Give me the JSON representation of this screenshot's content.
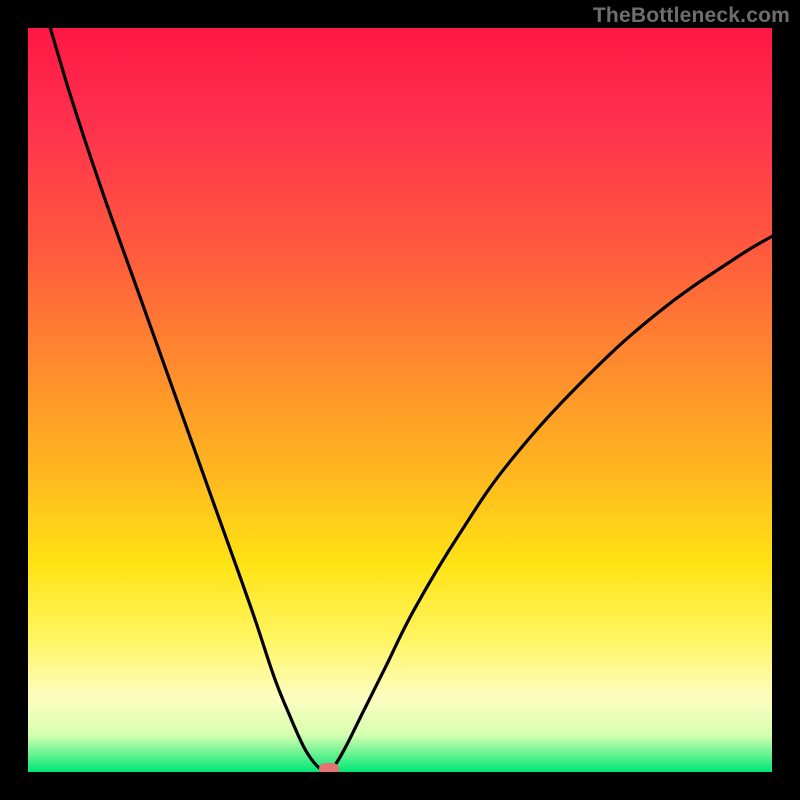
{
  "watermark": "TheBottleneck.com",
  "chart_data": {
    "type": "line",
    "title": "",
    "xlabel": "",
    "ylabel": "",
    "xlim": [
      0,
      100
    ],
    "ylim": [
      0,
      100
    ],
    "grid": false,
    "series": [
      {
        "name": "bottleneck-curve",
        "x": [
          3,
          6,
          10,
          15,
          20,
          25,
          30,
          33,
          35,
          37,
          38.5,
          39.5,
          40,
          40.8,
          42.5,
          45,
          48,
          52,
          58,
          65,
          75,
          85,
          95,
          100
        ],
        "values": [
          100,
          90,
          78,
          64,
          50,
          36,
          22,
          13,
          8,
          3.5,
          1.2,
          0.3,
          0,
          0.3,
          3,
          8,
          14,
          22,
          32,
          42,
          53,
          62,
          69,
          72
        ]
      }
    ],
    "marker": {
      "x": 40.4,
      "y": 0
    },
    "gradient_stops": [
      {
        "pct": 0,
        "color": "#ff1744"
      },
      {
        "pct": 12,
        "color": "#ff2f4e"
      },
      {
        "pct": 30,
        "color": "#ff5a3e"
      },
      {
        "pct": 45,
        "color": "#ff8a2e"
      },
      {
        "pct": 60,
        "color": "#ffb81f"
      },
      {
        "pct": 72,
        "color": "#ffe314"
      },
      {
        "pct": 82,
        "color": "#fff560"
      },
      {
        "pct": 90,
        "color": "#fdfdc0"
      },
      {
        "pct": 95,
        "color": "#d6ffb0"
      },
      {
        "pct": 100,
        "color": "#00e676"
      }
    ]
  }
}
